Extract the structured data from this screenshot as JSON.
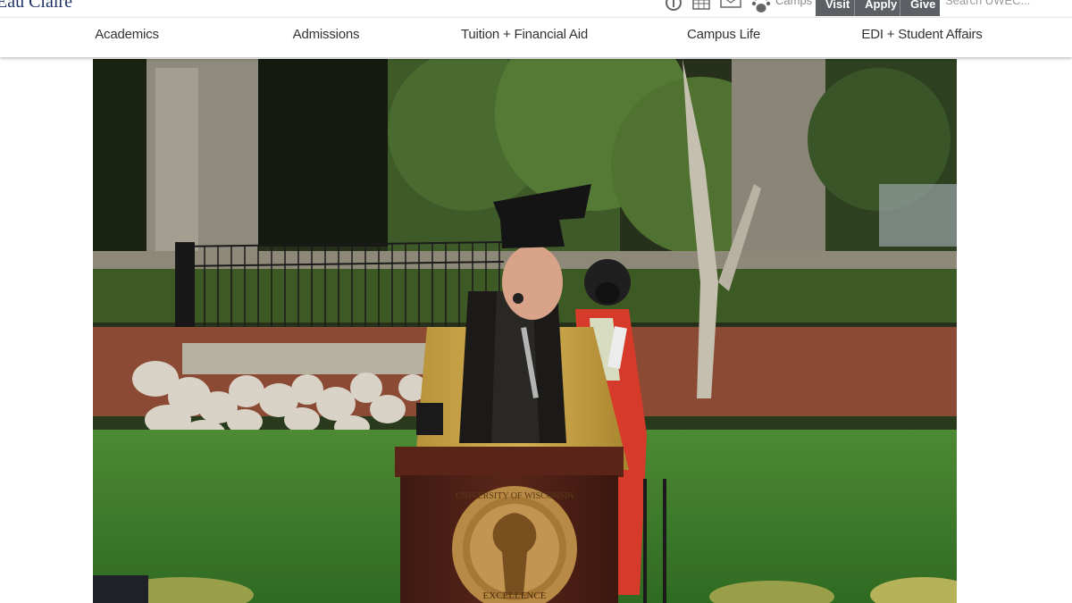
{
  "brand": {
    "logo_text": "Eau Claire"
  },
  "utility": {
    "icons": [
      "accessibility-icon",
      "calendar-icon",
      "mail-icon",
      "paw-icon"
    ],
    "camps_label": "Camps",
    "buttons": [
      {
        "label": "Visit"
      },
      {
        "label": "Apply"
      },
      {
        "label": "Give"
      }
    ],
    "search_text": "Search UWEC..."
  },
  "nav": {
    "items": [
      {
        "label": "Academics"
      },
      {
        "label": "Admissions"
      },
      {
        "label": "Tuition + Financial Aid"
      },
      {
        "label": "Campus Life"
      },
      {
        "label": "EDI + Student Affairs"
      }
    ]
  },
  "video": {
    "seal_text": "UNIVERSITY OF WISCONSIN",
    "seal_motto": "EXCELLENCE"
  },
  "colors": {
    "nav_text": "#333333",
    "button_bg": "#5c6065",
    "brand_navy": "#1f3366",
    "gown_gold": "#c9a447",
    "robe_red": "#d63a2a",
    "lawn_green": "#3d7a2a"
  }
}
